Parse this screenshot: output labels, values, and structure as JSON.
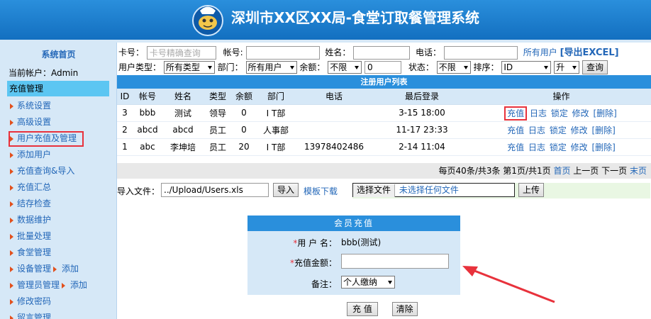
{
  "header": {
    "title": "深圳市XX区XX局-食堂订取餐管理系统"
  },
  "sidebar": {
    "home": "系统首页",
    "current_user": "当前帐户：Admin",
    "section": "充值管理",
    "items": [
      {
        "label": "系统设置"
      },
      {
        "label": "高级设置"
      },
      {
        "label": "用户充值及管理"
      },
      {
        "label": "添加用户"
      },
      {
        "label": "充值查询&导入"
      },
      {
        "label": "充值汇总"
      },
      {
        "label": "结存检查"
      },
      {
        "label": "数据维护"
      },
      {
        "label": "批量处理"
      },
      {
        "label": "食堂管理"
      },
      {
        "label": "设备管理",
        "sub": "添加"
      },
      {
        "label": "管理员管理",
        "sub": "添加"
      },
      {
        "label": "修改密码"
      },
      {
        "label": "留言管理"
      }
    ]
  },
  "filters": {
    "card_label": "卡号：",
    "card_placeholder": "卡号精确查询",
    "account_label": "帐号:",
    "name_label": "姓名：",
    "phone_label": "电话：",
    "all_users_link": "所有用户",
    "export_link": "[导出EXCEL]",
    "user_type_label": "用户类型：",
    "user_type_value": "所有类型",
    "dept_label": "部门：",
    "dept_value": "所有用户",
    "balance_label": "余额：",
    "balance_op": "不限",
    "balance_value": "0",
    "status_label": "状态：",
    "status_value": "不限",
    "sort_label": "排序：",
    "sort_field": "ID",
    "sort_dir": "升",
    "query_button": "查询"
  },
  "table": {
    "title": "注册用户列表",
    "headers": [
      "ID",
      "帐号",
      "姓名",
      "类型",
      "余额",
      "部门",
      "电话",
      "最后登录",
      "操作"
    ],
    "rows": [
      {
        "id": "3",
        "account": "bbb",
        "name": "测试",
        "type": "领导",
        "balance": "0",
        "dept": "I T部",
        "phone": "",
        "last_login": "3-15 18:00"
      },
      {
        "id": "2",
        "account": "abcd",
        "name": "abcd",
        "type": "员工",
        "balance": "0",
        "dept": "人事部",
        "phone": "",
        "last_login": "11-17 23:33"
      },
      {
        "id": "1",
        "account": "abc",
        "name": "李坤培",
        "type": "员工",
        "balance": "20",
        "dept": "I T部",
        "phone": "13978402486",
        "last_login": "2-14 11:04"
      }
    ],
    "ops": {
      "recharge": "充值",
      "log": "日志",
      "lock": "锁定",
      "edit": "修改",
      "delete": "[删除]"
    },
    "pager": {
      "summary": "每页40条/共3条 第1页/共1页",
      "first": "首页",
      "prev": "上一页",
      "next": "下一页",
      "last": "末页"
    }
  },
  "import": {
    "label": "导入文件：",
    "path_value": "../Upload/Users.xls",
    "import_button": "导入",
    "template_link": "模板下载",
    "choose_file_button": "选择文件",
    "no_file_text": "未选择任何文件",
    "upload_button": "上传"
  },
  "recharge_form": {
    "title": "会员充值",
    "username_label": "用 户 名：",
    "username_value": "bbb(测试)",
    "amount_label": "充值金额：",
    "amount_value": "",
    "note_label": "备注：",
    "note_value": "个人缴纳",
    "submit_button": "充 值",
    "clear_button": "清除"
  },
  "colors": {
    "header_blue": "#1a7fd0",
    "sidebar_bg": "#d6e8f7",
    "section_bg": "#5cc6f2",
    "link_blue": "#2367b8",
    "highlight_red": "#e8323c"
  }
}
